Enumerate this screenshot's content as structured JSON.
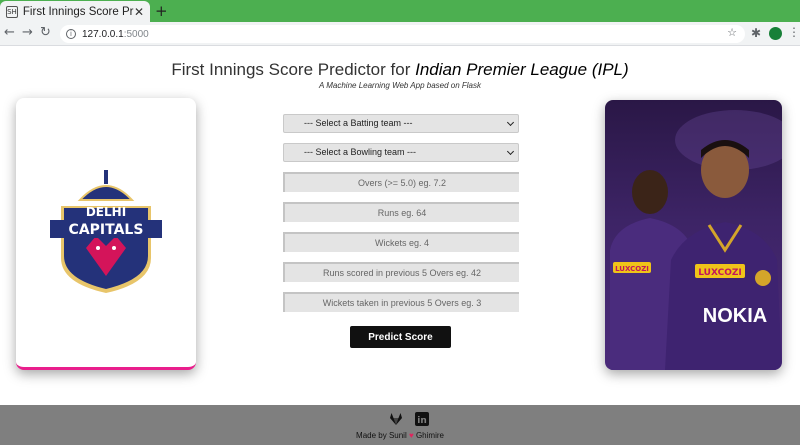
{
  "browser": {
    "tab_title": "First Innings Score Predictor",
    "favicon_text": "SH",
    "url_host": "127.0.0.1",
    "url_port": ":5000"
  },
  "header": {
    "title_prefix": "First Innings Score Predictor for",
    "title_emphasis": "Indian Premier League (IPL)",
    "subtitle": "A Machine Learning Web App based on Flask"
  },
  "form": {
    "batting_select": "--- Select a Batting team ---",
    "bowling_select": "--- Select a Bowling team ---",
    "overs_placeholder": "Overs (>= 5.0) eg. 7.2",
    "runs_placeholder": "Runs eg. 64",
    "wickets_placeholder": "Wickets eg. 4",
    "runs_prev5_placeholder": "Runs scored in previous 5 Overs eg. 42",
    "wickets_prev5_placeholder": "Wickets taken in previous 5 Overs eg. 3",
    "submit_label": "Predict Score"
  },
  "left_card": {
    "logo_line1": "DELHI",
    "logo_line2": "CAPITALS"
  },
  "right_card": {
    "sponsor1": "LUXCOZI",
    "sponsor2": "LUXCOZI",
    "sponsor3": "NOKIA"
  },
  "footer": {
    "made_by_prefix": "Made by Sunil",
    "heart": "♥",
    "made_by_suffix": "Ghimire",
    "linkedin_label": "in"
  },
  "colors": {
    "tabbar": "#4caf50",
    "footer": "#7f7f7f",
    "button": "#111111",
    "accent_pink": "#e91e8c"
  }
}
